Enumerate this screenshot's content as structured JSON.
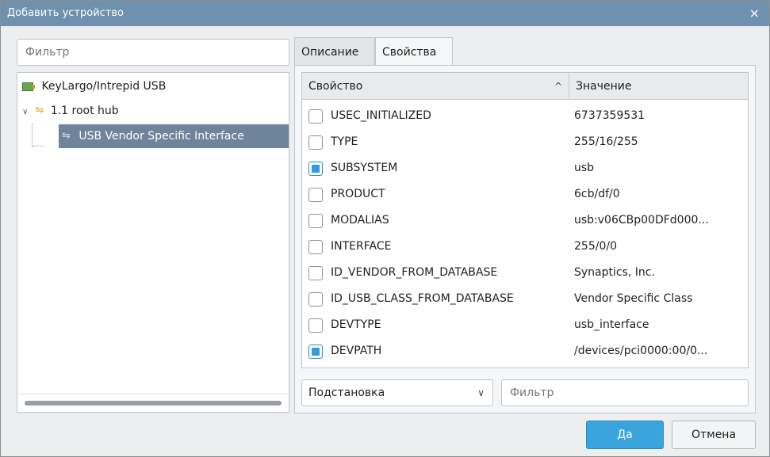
{
  "window": {
    "title": "Добавить устройство",
    "close_glyph": "×"
  },
  "left": {
    "filter_placeholder": "Фильтр",
    "tree": [
      {
        "label": "KeyLargo/Intrepid USB",
        "icon": "pci-card-icon"
      },
      {
        "label": "1.1 root hub",
        "icon": "usb-icon",
        "expanded": true
      },
      {
        "label": "USB Vendor Specific Interface",
        "icon": "usb-icon",
        "selected": true
      }
    ]
  },
  "tabs": [
    {
      "label": "Описание",
      "active": false
    },
    {
      "label": "Свойства",
      "active": true
    }
  ],
  "table": {
    "headers": {
      "property": "Свойство",
      "value": "Значение"
    },
    "sort_glyph": "^",
    "rows": [
      {
        "checked": false,
        "property": "USEC_INITIALIZED",
        "value": "6737359531"
      },
      {
        "checked": false,
        "property": "TYPE",
        "value": "255/16/255"
      },
      {
        "checked": true,
        "property": "SUBSYSTEM",
        "value": "usb"
      },
      {
        "checked": false,
        "property": "PRODUCT",
        "value": "6cb/df/0"
      },
      {
        "checked": false,
        "property": "MODALIAS",
        "value": "usb:v06CBp00DFd000..."
      },
      {
        "checked": false,
        "property": "INTERFACE",
        "value": "255/0/0"
      },
      {
        "checked": false,
        "property": "ID_VENDOR_FROM_DATABASE",
        "value": "Synaptics, Inc."
      },
      {
        "checked": false,
        "property": "ID_USB_CLASS_FROM_DATABASE",
        "value": "Vendor Specific Class"
      },
      {
        "checked": false,
        "property": "DEVTYPE",
        "value": "usb_interface"
      },
      {
        "checked": true,
        "property": "DEVPATH",
        "value": "/devices/pci0000:00/0..."
      }
    ]
  },
  "bottom": {
    "mode_select": "Подстановка",
    "chevron_glyph": "⌄",
    "filter_placeholder": "Фильтр"
  },
  "buttons": {
    "ok": "Да",
    "cancel": "Отмена"
  },
  "colors": {
    "titlebar": "#6f91ae",
    "selection": "#6e849b",
    "accent": "#3aa4dc"
  }
}
